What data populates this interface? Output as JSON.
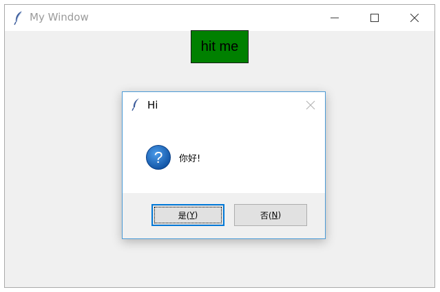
{
  "window": {
    "title": "My Window",
    "hit_button_label": "hit me"
  },
  "dialog": {
    "title": "Hi",
    "message": "你好!",
    "yes": {
      "label": "是(",
      "key": "Y",
      "close": ")"
    },
    "no": {
      "label": "否(",
      "key": "N",
      "close": ")"
    },
    "icon": "question-icon"
  },
  "colors": {
    "hit_button_bg": "#008000",
    "dialog_border": "#4a9ad6",
    "question_icon": "#1565c0",
    "focus_border": "#0078d7"
  }
}
